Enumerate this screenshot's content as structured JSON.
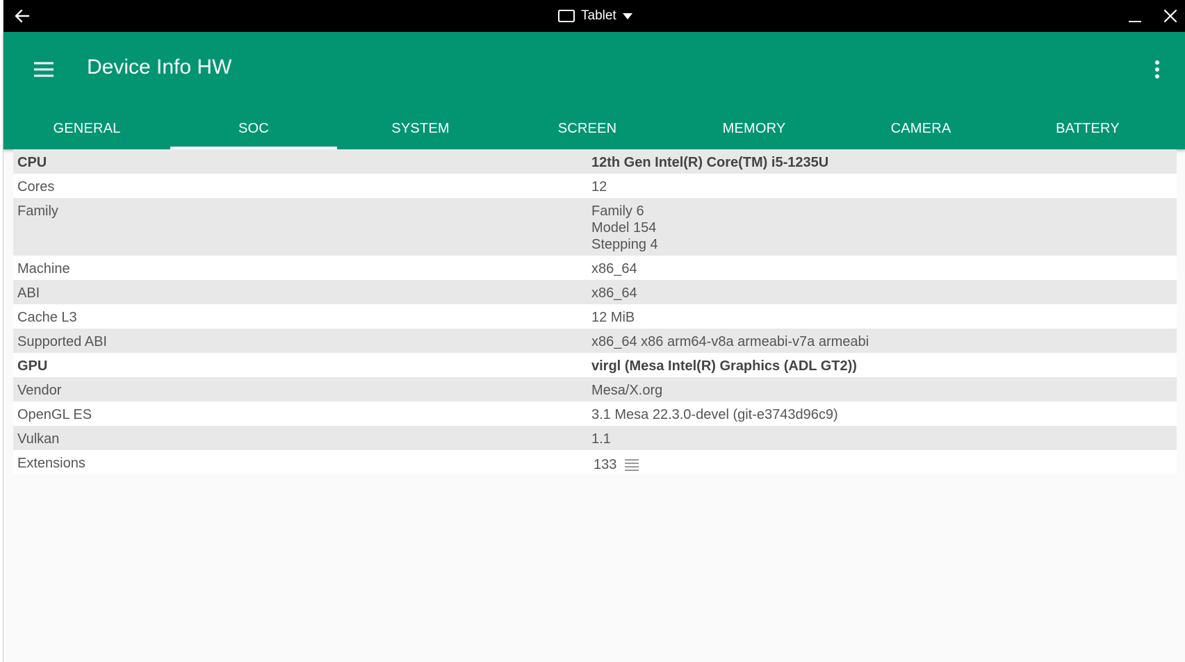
{
  "window": {
    "mode_label": "Tablet",
    "icons": {
      "back": "arrow-left-icon",
      "mode": "tablet-icon",
      "dropdown": "caret-down-icon",
      "minimize": "minimize-icon",
      "close": "close-icon"
    }
  },
  "app": {
    "title": "Device Info HW",
    "icons": {
      "menu": "hamburger-menu-icon",
      "overflow": "more-vert-icon"
    },
    "accent_color": "#039572"
  },
  "tabs": [
    {
      "label": "GENERAL",
      "active": false
    },
    {
      "label": "SOC",
      "active": true
    },
    {
      "label": "SYSTEM",
      "active": false
    },
    {
      "label": "SCREEN",
      "active": false
    },
    {
      "label": "MEMORY",
      "active": false
    },
    {
      "label": "CAMERA",
      "active": false
    },
    {
      "label": "BATTERY",
      "active": false
    }
  ],
  "soc": {
    "cpu": {
      "label": "CPU",
      "value": "12th Gen Intel(R) Core(TM) i5-1235U"
    },
    "cores": {
      "label": "Cores",
      "value": "12"
    },
    "family": {
      "label": "Family",
      "lines": [
        "Family 6",
        "Model 154",
        "Stepping 4"
      ]
    },
    "machine": {
      "label": "Machine",
      "value": "x86_64"
    },
    "abi": {
      "label": "ABI",
      "value": "x86_64"
    },
    "cache_l3": {
      "label": "Cache L3",
      "value": "12 MiB"
    },
    "supported_abi": {
      "label": "Supported ABI",
      "value": "x86_64 x86 arm64-v8a armeabi-v7a armeabi"
    },
    "gpu": {
      "label": "GPU",
      "value": "virgl (Mesa Intel(R) Graphics (ADL GT2))"
    },
    "vendor": {
      "label": "Vendor",
      "value": "Mesa/X.org"
    },
    "opengl": {
      "label": "OpenGL ES",
      "value": "3.1 Mesa 22.3.0-devel (git-e3743d96c9)"
    },
    "vulkan": {
      "label": "Vulkan",
      "value": "1.1"
    },
    "extensions": {
      "label": "Extensions",
      "value": "133",
      "icon": "list-icon"
    }
  }
}
